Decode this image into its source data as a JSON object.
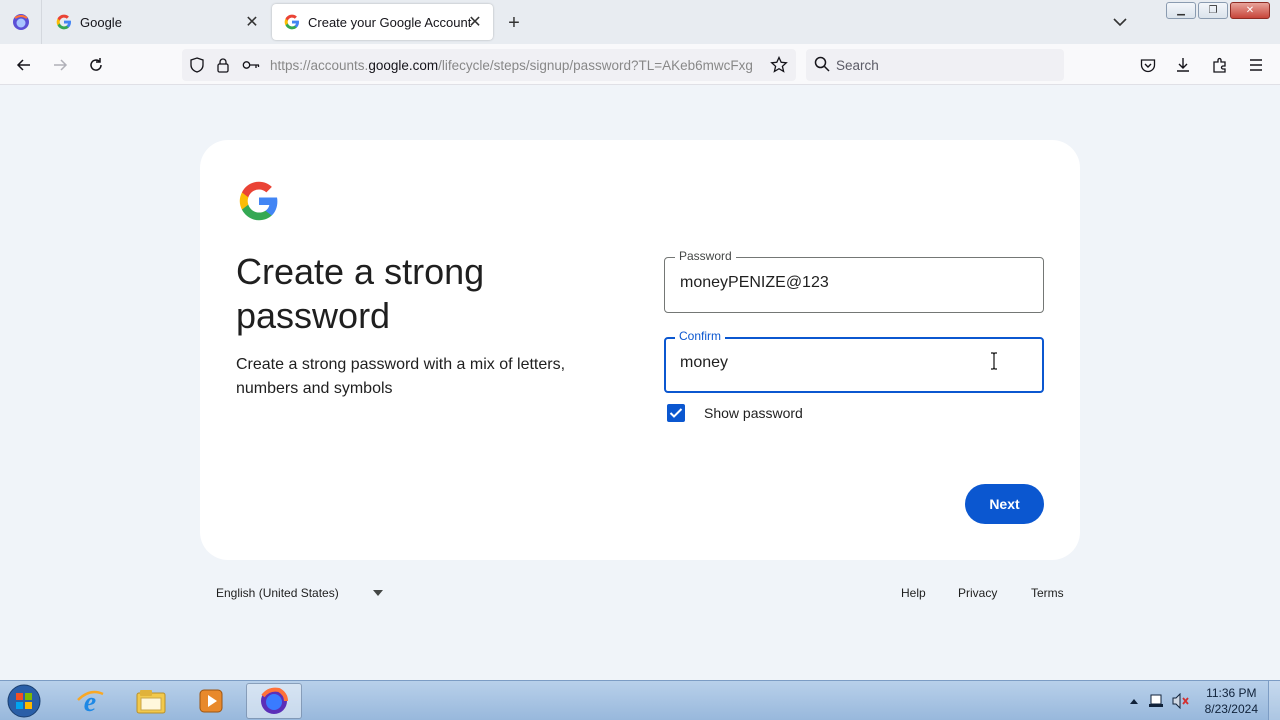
{
  "browser": {
    "tabs": [
      {
        "title": "Google",
        "active": false
      },
      {
        "title": "Create your Google Account",
        "active": true
      }
    ],
    "url_prefix": "https://accounts.",
    "url_domain": "google.com",
    "url_path": "/lifecycle/steps/signup/password?TL=AKeb6mwcFxg",
    "search_placeholder": "Search"
  },
  "signup": {
    "heading": "Create a strong password",
    "subtext": "Create a strong password with a mix of letters, numbers and symbols",
    "password_label": "Password",
    "password_value": "moneyPENIZE@123",
    "confirm_label": "Confirm",
    "confirm_value": "money",
    "show_password_label": "Show password",
    "show_password_checked": true,
    "next_label": "Next"
  },
  "footer": {
    "language": "English (United States)",
    "help": "Help",
    "privacy": "Privacy",
    "terms": "Terms"
  },
  "taskbar": {
    "time": "11:36 PM",
    "date": "8/23/2024"
  },
  "colors": {
    "primary": "#0b57d0",
    "background": "#f0f4f9"
  }
}
